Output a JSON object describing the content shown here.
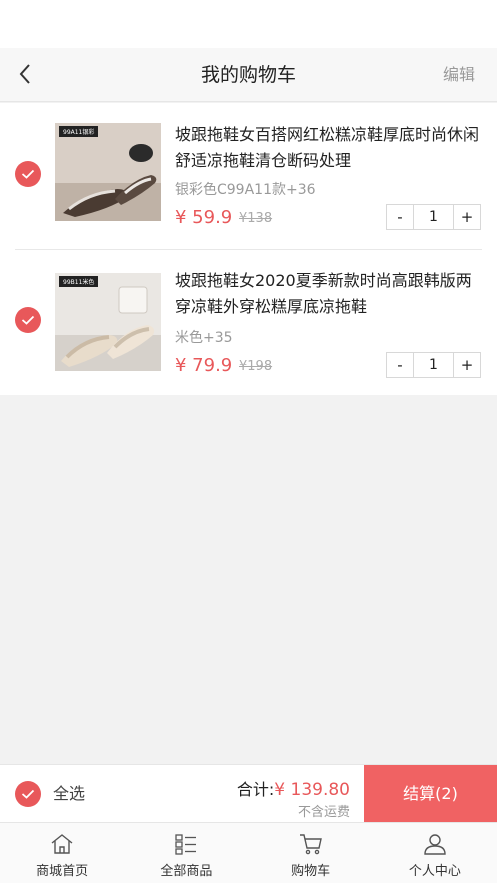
{
  "navbar": {
    "title": "我的购物车",
    "edit_label": "编辑"
  },
  "cart": {
    "items": [
      {
        "title": "坡跟拖鞋女百搭网红松糕凉鞋厚底时尚休闲舒适凉拖鞋清仓断码处理",
        "spec": "银彩色C99A11款+36",
        "price": "¥ 59.9",
        "original_price": "¥138",
        "quantity": "1",
        "minus_label": "-",
        "plus_label": "+",
        "checked": true,
        "thumb_tag": "99A11银彩"
      },
      {
        "title": "坡跟拖鞋女2020夏季新款时尚高跟韩版两穿凉鞋外穿松糕厚底凉拖鞋",
        "spec": "米色+35",
        "price": "¥ 79.9",
        "original_price": "¥198",
        "quantity": "1",
        "minus_label": "-",
        "plus_label": "+",
        "checked": true,
        "thumb_tag": "99B11米色"
      }
    ]
  },
  "bottom_bar": {
    "select_all_label": "全选",
    "total_label": "合计:",
    "total_value": "¥ 139.80",
    "shipping_note": "不含运费",
    "checkout_label": "结算(2)"
  },
  "tabbar": {
    "tabs": [
      {
        "label": "商城首页",
        "icon": "home-icon"
      },
      {
        "label": "全部商品",
        "icon": "category-list-icon"
      },
      {
        "label": "购物车",
        "icon": "cart-icon"
      },
      {
        "label": "个人中心",
        "icon": "person-icon"
      }
    ]
  },
  "colors": {
    "accent": "#e8585a",
    "checkout_bg": "#f06263",
    "muted_text": "#999999",
    "page_bg": "#f2f2f2"
  }
}
